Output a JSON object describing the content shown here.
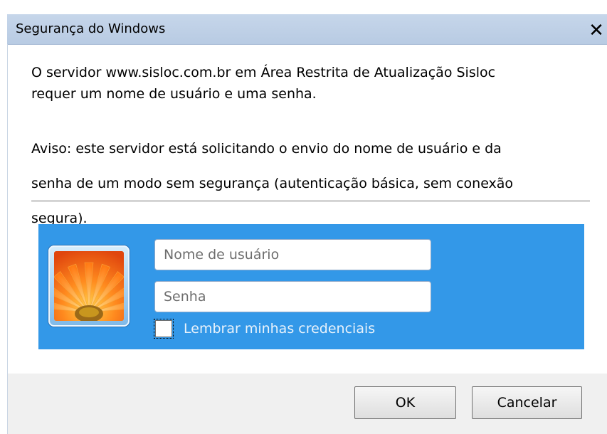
{
  "window": {
    "title": "Segurança do Windows",
    "close_label": "✕"
  },
  "message": {
    "line1": "O servidor www.sisloc.com.br em Área Restrita de Atualização Sisloc",
    "line2": "requer um nome de usuário e uma senha."
  },
  "warning": {
    "line1": "Aviso: este servidor está solicitando o envio do nome de usuário e da",
    "line2": "senha de um modo sem segurança (autenticação básica, sem conexão",
    "line3": "segura)."
  },
  "credentials": {
    "panel_color": "#3398e8",
    "avatar_icon": "flower-user-tile-icon",
    "username": {
      "placeholder": "Nome de usuário",
      "value": ""
    },
    "password": {
      "placeholder": "Senha",
      "value": ""
    },
    "remember": {
      "label": "Lembrar minhas credenciais",
      "checked": false
    }
  },
  "buttons": {
    "ok": "OK",
    "cancel": "Cancelar"
  }
}
